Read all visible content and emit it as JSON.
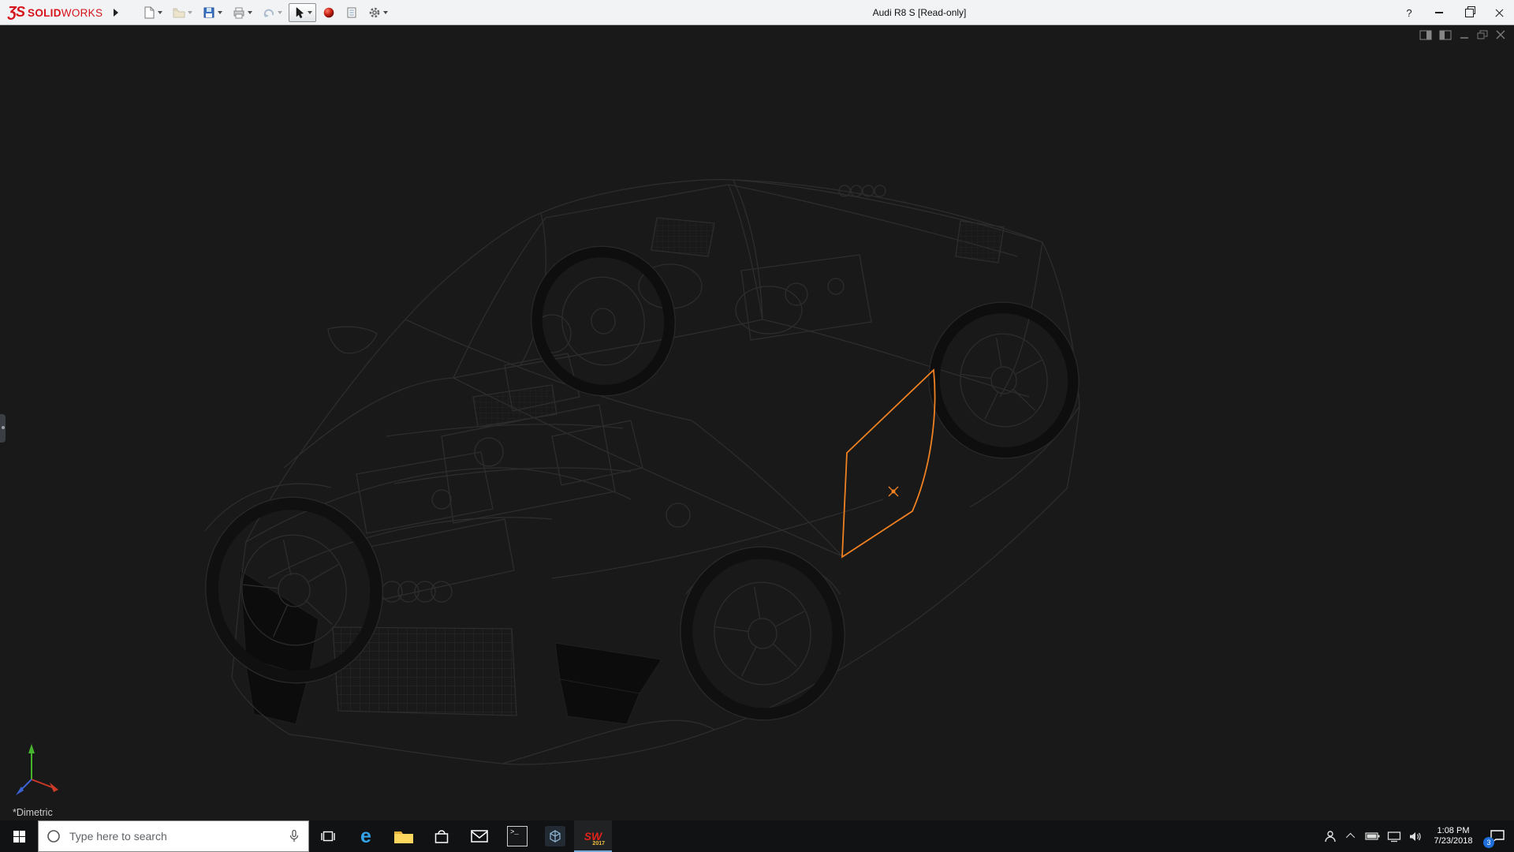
{
  "window": {
    "title": "Audi R8 S [Read-only]",
    "brand": {
      "mark": "ƷS",
      "bold": "SOLID",
      "light": "WORKS"
    },
    "controls": {
      "help": "?"
    }
  },
  "viewport": {
    "orientation_label": "*Dimetric",
    "background": "#191919",
    "wireframe_color": "#2d2d2d",
    "sketch_highlight_color": "#ef8122"
  },
  "taskbar": {
    "search_placeholder": "Type here to search",
    "edge_glyph": "e",
    "console_glyph": ">_",
    "solidworks_mark": "SW",
    "solidworks_year": "2017",
    "time": "1:08 PM",
    "date": "7/23/2018",
    "notification_badge": "3"
  },
  "colors": {
    "brand_red": "#d6121b",
    "badge_blue": "#1e6fd9"
  }
}
